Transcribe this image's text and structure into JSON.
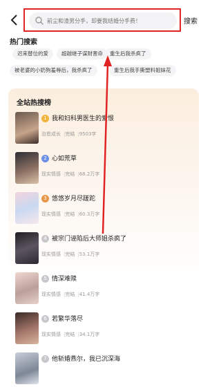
{
  "header": {
    "search_placeholder": "前尘和渣男分手，却要我结婚分手费！",
    "search_label": "搜索"
  },
  "hot_search": {
    "title": "热门搜索",
    "tags": [
      "迟来替位的爱",
      "超越继子谋财害命",
      "重生后我杀疯了",
      "被老婆的小奶狗羞辱后，我杀疯了",
      "重生后我手撕塑料姐妹花"
    ]
  },
  "ranking": {
    "title": "全站热搜榜",
    "books": [
      {
        "rank": "1",
        "title": "我和妇科男医生的爱恨",
        "genre": "治愈成长",
        "status": "完结",
        "words": "9503字"
      },
      {
        "rank": "2",
        "title": "心如荒草",
        "genre": "现实情感",
        "status": "完结",
        "words": "68.2万字"
      },
      {
        "rank": "3",
        "title": "悠悠岁月尽蹉跎",
        "genre": "现实情感",
        "status": "完结",
        "words": "60.3万字"
      },
      {
        "rank": "4",
        "title": "被宗门诬陷后大师姐杀疯了",
        "genre": "现实情感",
        "status": "完结",
        "words": "53.1万字"
      },
      {
        "rank": "5",
        "title": "情深难赎",
        "genre": "现实情感",
        "status": "完结",
        "words": "41.4万字"
      },
      {
        "rank": "6",
        "title": "若繁华落尽",
        "genre": "现实情感",
        "status": "完结",
        "words": "34.1万字"
      },
      {
        "rank": "7",
        "title": "他斩婚燕尔，我已沉深海",
        "genre": "",
        "status": "",
        "words": ""
      }
    ]
  },
  "colors": {
    "highlight": "#e02424",
    "rank1": "#f2b53c",
    "rank2": "#6d8fe8",
    "rank3": "#e8964a",
    "rank_other": "#c7c7cc"
  }
}
